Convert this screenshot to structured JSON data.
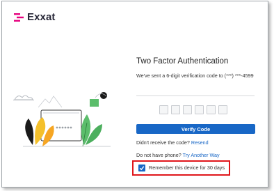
{
  "brand": {
    "name": "Exxat",
    "color": "#e6007e"
  },
  "auth": {
    "title": "Two Factor Authentication",
    "sent_message": "We've sent a 6-digit verification code to (***) ***-4599",
    "code_length": 6,
    "verify_label": "Verify Code",
    "not_received_text": "Didn't receive the code?",
    "resend_label": "Resend",
    "no_phone_text": "Do not have phone?",
    "try_another_label": "Try Another Way",
    "remember_label": "Remember this device for 30 days",
    "remember_checked": true
  },
  "colors": {
    "primary": "#1867c6",
    "highlight": "#e0161b"
  }
}
